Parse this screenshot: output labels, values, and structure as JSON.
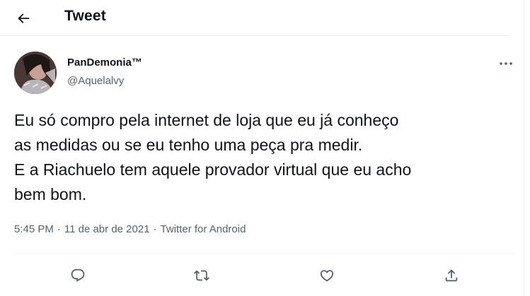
{
  "header": {
    "title": "Tweet",
    "back_icon": "arrow-left-icon"
  },
  "author": {
    "display_name": "PanDemonia™",
    "handle": "@Aquelalvy",
    "avatar_icon": "profile-photo",
    "more_icon": "more-options-icon"
  },
  "tweet": {
    "lines": [
      "Eu só compro pela internet de loja que eu já conheço",
      "as medidas ou se eu tenho uma peça pra medir.",
      "E a Riachuelo tem aquele provador virtual que eu acho",
      "bem bom."
    ]
  },
  "meta": {
    "time": "5:45 PM",
    "separator": "·",
    "date": "11 de abr de 2021",
    "source": "Twitter for Android"
  },
  "actions": {
    "reply_icon": "reply-icon",
    "retweet_icon": "retweet-icon",
    "like_icon": "like-icon",
    "share_icon": "share-icon",
    "icon_color": "#536471"
  },
  "colors": {
    "text": "#0f1419",
    "secondary": "#536471",
    "border": "#eff3f4"
  }
}
